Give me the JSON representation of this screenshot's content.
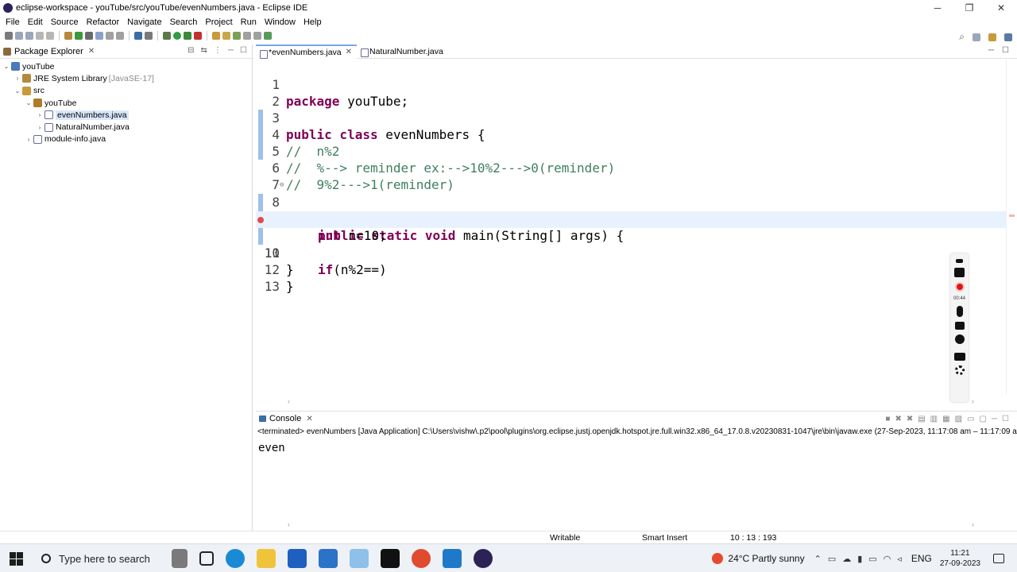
{
  "window": {
    "title": "eclipse-workspace - youTube/src/youTube/evenNumbers.java - Eclipse IDE",
    "controls": [
      "─",
      "❐",
      "✕"
    ]
  },
  "menu": [
    "File",
    "Edit",
    "Source",
    "Refactor",
    "Navigate",
    "Search",
    "Project",
    "Run",
    "Window",
    "Help"
  ],
  "package_explorer": {
    "title": "Package Explorer",
    "items": [
      {
        "label": "youTube",
        "extra": ""
      },
      {
        "label": "JRE System Library",
        "extra": "[JavaSE-17]"
      },
      {
        "label": "src",
        "extra": ""
      },
      {
        "label": "youTube",
        "extra": ""
      },
      {
        "label": "evenNumbers.java",
        "extra": ""
      },
      {
        "label": "NaturalNumber.java",
        "extra": ""
      },
      {
        "label": "module-info.java",
        "extra": ""
      }
    ]
  },
  "editor": {
    "tabs": [
      {
        "label": "*evenNumbers.java"
      },
      {
        "label": "NaturalNumber.java"
      }
    ],
    "line_numbers": [
      "1",
      "2",
      "3",
      "4",
      "5",
      "6",
      "7",
      "8",
      "9",
      "10",
      "11",
      "12",
      "13"
    ],
    "lines": {
      "l1_kw": "package",
      "l1_rest": " youTube;",
      "l3_kw": "public class",
      "l3_rest": " evenNumbers {",
      "l4": "//  n%2",
      "l5": "//  %--> reminder ex:-->10%2--->0(reminder)",
      "l6": "//  9%2--->1(reminder)",
      "l8_kw": "public static void",
      "l8_rest": " main(String[] args) {",
      "l9_kw": "int",
      "l9_rest": " n=10;",
      "l10_kw": "if",
      "l10_rest": "(n%2==)",
      "l11": "}",
      "l12": "}"
    }
  },
  "console": {
    "title": "Console",
    "status": "<terminated> evenNumbers [Java Application] C:\\Users\\vishw\\.p2\\pool\\plugins\\org.eclipse.justj.openjdk.hotspot.jre.full.win32.x86_64_17.0.8.v20230831-1047\\jre\\bin\\javaw.exe  (27-Sep-2023, 11:17:08 am – 11:17:09 am",
    "output": "even"
  },
  "statusbar": {
    "mode": "Writable",
    "insert": "Smart Insert",
    "position": "10 : 13 : 193"
  },
  "recorder": {
    "time": "00:44"
  },
  "taskbar": {
    "search_placeholder": "Type here to search",
    "weather": "24°C  Partly sunny",
    "language": "ENG",
    "time": "11:21",
    "date": "27-09-2023"
  }
}
